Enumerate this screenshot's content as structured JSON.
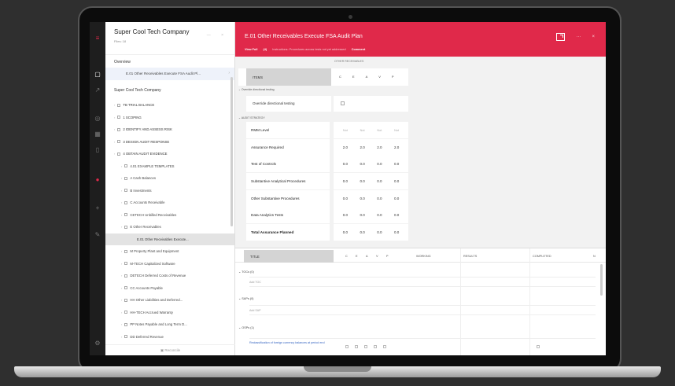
{
  "sidebar": {
    "company": "Super Cool Tech Company",
    "subline": "Files: 18",
    "overview_label": "Overview",
    "overview_item": "E.01 Other Receivables Execute FSA Audit Pl...",
    "section_label": "Super Cool Tech Company",
    "footer": "Reconcile",
    "items": [
      {
        "label": "TB TRIAL BALANCE",
        "level": 1
      },
      {
        "label": "1 SCOPING",
        "level": 1
      },
      {
        "label": "2 IDENTIFY AND ASSESS RISK",
        "level": 1
      },
      {
        "label": "3 DESIGN AUDIT RESPONSE",
        "level": 1
      },
      {
        "label": "4 OBTAIN AUDIT EVIDENCE",
        "level": 1
      },
      {
        "label": "4.01 EXAMPLE TEMPLATES",
        "level": 2
      },
      {
        "label": "A Cash Balances",
        "level": 2
      },
      {
        "label": "B Investments",
        "level": 2
      },
      {
        "label": "C Accounts Receivable",
        "level": 2
      },
      {
        "label": "CETECH Unbilled Receivables",
        "level": 2
      },
      {
        "label": "E Other Receivables",
        "level": 2
      },
      {
        "label": "E.01 Other Receivables Execute...",
        "level": 3
      },
      {
        "label": "M Property Plant and Equipment",
        "level": 2
      },
      {
        "label": "M-TECH Capitalized Software",
        "level": 2
      },
      {
        "label": "DETECH Deferred Costs of Revenue",
        "level": 2
      },
      {
        "label": "CC Accounts Payable",
        "level": 2
      },
      {
        "label": "HH Other Liabilities and Deferred...",
        "level": 2
      },
      {
        "label": "HH-TECH Accrued Warranty",
        "level": 2
      },
      {
        "label": "PP Notes Payable and Long Term D...",
        "level": 2
      },
      {
        "label": "DD Deferred Revenue",
        "level": 2
      }
    ]
  },
  "header": {
    "title": "E.01 Other Receivables Execute FSA Audit Plan",
    "view_full": "View Full",
    "ref": "(4)",
    "subtitle_desc": "Instructions: Procedures across tests not yet addressed",
    "comment": "Comment"
  },
  "rating": {
    "group_label": "OTHER RECEIVABLES",
    "row_label": "ITEMS",
    "columns": [
      "C",
      "E",
      "A",
      "V",
      "P"
    ]
  },
  "override": {
    "section": "Override directional testing",
    "label": "Override directional testing"
  },
  "strategy": {
    "section": "AUDIT STRATEGY",
    "head_label": "RMM Level",
    "head_values": [
      "Not",
      "Not",
      "Not",
      "Not"
    ],
    "rows": [
      {
        "label": "Assurance Required",
        "values": [
          "2.0",
          "2.0",
          "2.0",
          "2.0"
        ],
        "bold": false
      },
      {
        "label": "Test of Controls",
        "values": [
          "0.0",
          "0.0",
          "0.0",
          "0.0"
        ],
        "bold": false
      },
      {
        "label": "Substantive Analytical Procedures",
        "values": [
          "0.0",
          "0.0",
          "0.0",
          "0.0"
        ],
        "bold": false
      },
      {
        "label": "Other Substantive Procedures",
        "values": [
          "0.0",
          "0.0",
          "0.0",
          "0.0"
        ],
        "bold": false
      },
      {
        "label": "Data Analytics Tests",
        "values": [
          "0.0",
          "0.0",
          "0.0",
          "0.0"
        ],
        "bold": false
      },
      {
        "label": "Total Assurance Planned",
        "values": [
          "0.0",
          "0.0",
          "0.0",
          "0.0"
        ],
        "bold": true
      }
    ]
  },
  "table": {
    "title": "TITLE",
    "assertion_cols": [
      "C",
      "E",
      "A",
      "V",
      "P"
    ],
    "col_wrkg": "WORKING",
    "col_results": "RESULTS",
    "col_completed": "COMPLETED",
    "col_end": "N",
    "groups": [
      {
        "label": "TOCs (0)",
        "add": "Add TOC"
      },
      {
        "label": "SAPs (0)",
        "add": "Add SAP"
      },
      {
        "label": "OSPs (1)",
        "add": ""
      }
    ],
    "row_link": "Reclassification of foreign currency balances at period end"
  },
  "colors": {
    "accent": "#e0294a",
    "rail": "#1e1e1e",
    "link": "#3766c2"
  }
}
